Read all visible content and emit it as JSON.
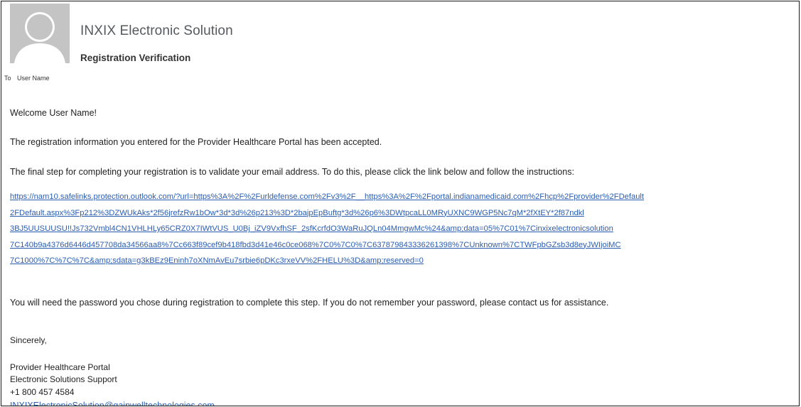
{
  "header": {
    "sender_name": "INXIX Electronic Solution",
    "subject": "Registration Verification",
    "avatar_icon": "person-silhouette-icon"
  },
  "recipients": {
    "to_label": "To",
    "to_value": "User Name"
  },
  "body": {
    "greeting": "Welcome User Name!",
    "paragraph1": "The registration information you entered for the Provider Healthcare Portal has been accepted.",
    "paragraph2": "The final step for completing your registration is to validate your email address. To do this, please click the link below and follow the instructions:",
    "link_lines": [
      "https://nam10.safelinks.protection.outlook.com/?url=https%3A%2F%2Furldefense.com%2Fv3%2F__https%3A%2F%2Fportal.indianamedicaid.com%2Fhcp%2Fprovider%2FDefault",
      "2FDefault.aspx%3Fp212%3DZWUkAks*2f56jrefzRw1bOw*3d*3d%26p213%3D*2bajpEpBuftg*3d%26p6%3DWtpcaLL0MRyUXNC9WGP5Nc7qM*2fXtEY*2f87ndkl",
      "3BJ5UUSUUSU!!Js732Vmbl4CN1VHLHLy65CRZ0X7IWtVUS_U0Bj_iZV9VxfhSF_2sfKcrfdO3WaRuJQLn04MmgwMc%24&amp;data=05%7C01%7Cinxixelectronicsolution",
      "7C140b9a4376d6446d457708da34566aa8%7Cc663f89cef9b418fbd3d41e46c0ce068%7C0%7C0%7C637879843336261398%7CUnknown%7CTWFpbGZsb3d8eyJWIjoiMC",
      "7C1000%7C%7C%7C&amp;sdata=g3kBEz9Eninh7oXNmAvEu7srbie6pDKc3rxeVV%2FHELU%3D&amp;reserved=0"
    ],
    "paragraph3": "You will need the password you chose during registration to complete this step. If you do not remember your password, please contact us for assistance."
  },
  "signature": {
    "closing": "Sincerely,",
    "line1": "Provider Healthcare Portal",
    "line2": "Electronic Solutions Support",
    "phone": "+1 800 457 4584",
    "email": "INXIXElectronicSolution@gainwelltechnologies.com"
  }
}
